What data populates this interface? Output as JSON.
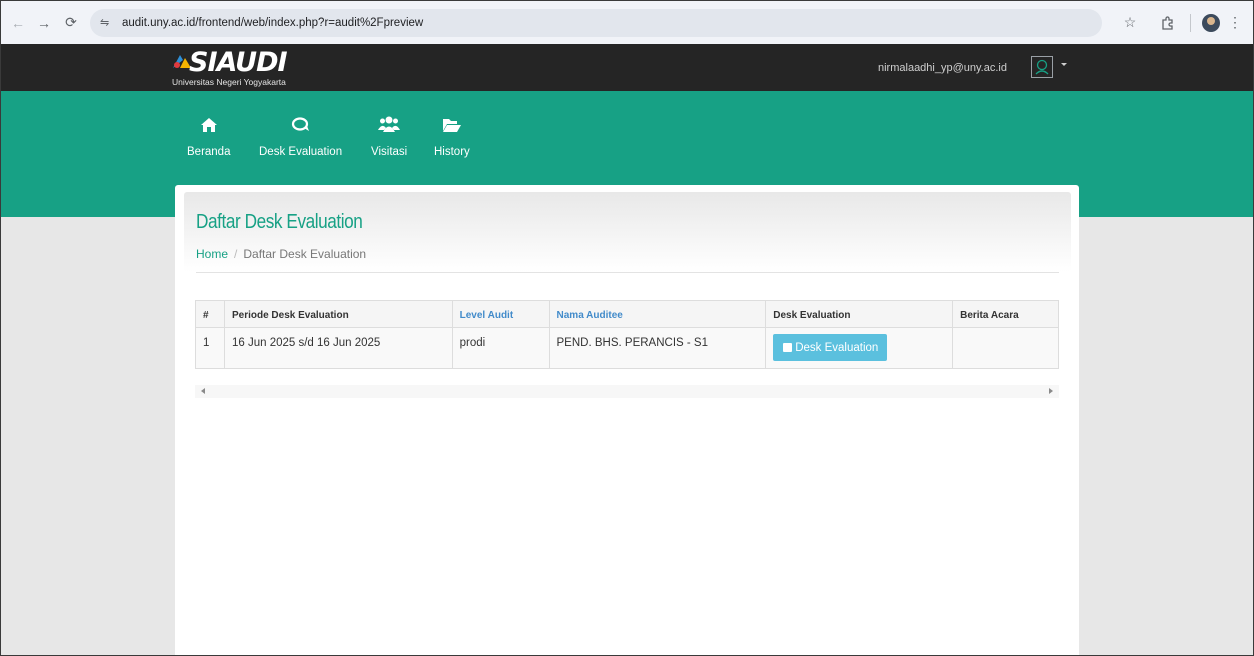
{
  "browser": {
    "url": "audit.uny.ac.id/frontend/web/index.php?r=audit%2Fpreview",
    "icons": [
      "back-icon",
      "forward-icon",
      "reload-icon",
      "site-info-icon",
      "star-icon",
      "extension-icon",
      "profile-icon",
      "kebab-menu-icon"
    ]
  },
  "header": {
    "logo_title": "SIAUDI",
    "logo_subtitle": "Universitas Negeri Yogyakarta",
    "user_email": "nirmalaadhi_yp@uny.ac.id"
  },
  "nav": {
    "items": [
      {
        "label": "Beranda",
        "icon": "home-icon"
      },
      {
        "label": "Desk Evaluation",
        "icon": "comments-icon"
      },
      {
        "label": "Visitasi",
        "icon": "users-icon"
      },
      {
        "label": "History",
        "icon": "folder-open-icon"
      }
    ]
  },
  "page": {
    "title": "Daftar Desk Evaluation",
    "breadcrumb": {
      "home": "Home",
      "separator": "/",
      "current": "Daftar Desk Evaluation"
    }
  },
  "table": {
    "headers": [
      "#",
      "Periode Desk Evaluation",
      "Level Audit",
      "Nama Auditee",
      "Desk Evaluation",
      "Berita Acara"
    ],
    "rows": [
      {
        "no": "1",
        "periode": "16 Jun 2025 s/d 16 Jun 2025",
        "level": "prodi",
        "auditee": "PEND. BHS. PERANCIS - S1",
        "action": "Desk Evaluation",
        "berita_acara": ""
      }
    ]
  },
  "colors": {
    "brand_green": "#17a185",
    "header_dark": "#252525",
    "info_button": "#5bc0de",
    "link_blue": "#428bca"
  }
}
